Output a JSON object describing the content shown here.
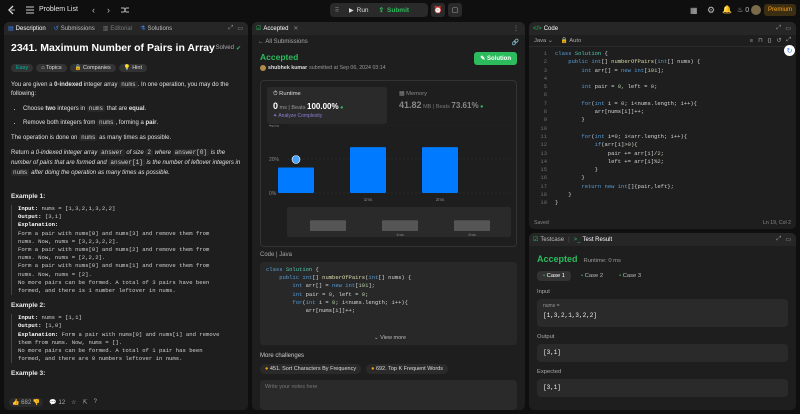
{
  "topbar": {
    "problem_list": "Problem List",
    "run": "Run",
    "submit": "Submit",
    "premium": "Premium",
    "fire_count": "0"
  },
  "desc_panel": {
    "tabs": [
      "Description",
      "Submissions",
      "Editorial",
      "Solutions"
    ],
    "title": "2341. Maximum Number of Pairs in Array",
    "solved": "Solved",
    "chips": [
      "Easy",
      "Topics",
      "Companies",
      "Hint"
    ],
    "p1a": "You are given a ",
    "p1b": "0-indexed",
    "p1c": " integer array ",
    "p1code": "nums",
    "p1d": ". In one operation, you may do the following:",
    "b1a": "Choose ",
    "b1b": "two",
    "b1c": " integers in ",
    "b1code": "nums",
    "b1d": " that are ",
    "b1e": "equal",
    "b2a": "Remove both integers from ",
    "b2code": "nums",
    "b2b": ", forming a ",
    "b2c": "pair",
    "p2a": "The operation is done on ",
    "p2code": "nums",
    "p2b": " as many times as possible.",
    "p3a": "Return ",
    "p3b": "a 0-indexed integer array ",
    "p3code1": "answer",
    "p3c": " of size ",
    "p3d": "2",
    "p3e": " where ",
    "p3code2": "answer[0]",
    "p3f": " is the number of pairs that are formed and ",
    "p3code3": "answer[1]",
    "p3g": " is the number of leftover integers in ",
    "p3code4": "nums",
    "p3h": " after doing the operation as many times as possible.",
    "ex1_title": "Example 1:",
    "ex1_lines": [
      [
        "Input:",
        " nums = [1,3,2,1,3,2,2]"
      ],
      [
        "Output:",
        " [3,1]"
      ],
      [
        "Explanation:",
        ""
      ],
      [
        "",
        "Form a pair with nums[0] and nums[3] and remove them from"
      ],
      [
        "",
        "nums. Now, nums = [3,2,3,2,2]."
      ],
      [
        "",
        "Form a pair with nums[0] and nums[2] and remove them from"
      ],
      [
        "",
        "nums. Now, nums = [2,2,2]."
      ],
      [
        "",
        "Form a pair with nums[0] and nums[1] and remove them from"
      ],
      [
        "",
        "nums. Now, nums = [2]."
      ],
      [
        "",
        "No more pairs can be formed. A total of 3 pairs have been"
      ],
      [
        "",
        "formed, and there is 1 number leftover in nums."
      ]
    ],
    "ex2_title": "Example 2:",
    "ex2_lines": [
      [
        "Input:",
        " nums = [1,1]"
      ],
      [
        "Output:",
        " [1,0]"
      ],
      [
        "Explanation:",
        " Form a pair with nums[0] and nums[1] and remove"
      ],
      [
        "",
        "them from nums. Now, nums = []."
      ],
      [
        "",
        "No more pairs can be formed. A total of 1 pair has been"
      ],
      [
        "",
        "formed, and there are 0 numbers leftover in nums."
      ]
    ],
    "ex3_title": "Example 3:",
    "likes": "682",
    "comments": "12"
  },
  "accepted_panel": {
    "tab": "Accepted",
    "all_submissions": "All Submissions",
    "status": "Accepted",
    "user": "shubhek kumar",
    "submitted": "submitted at Sep 06, 2024 03:14",
    "solution_btn": "Solution",
    "runtime_label": "Runtime",
    "runtime_value": "0",
    "runtime_unit": "ms",
    "beats_label": "Beats",
    "runtime_beats": "100.00%",
    "analyze": "Analyze Complexity",
    "memory_label": "Memory",
    "memory_value": "41.82",
    "memory_unit": "MB",
    "memory_beats": "73.61%",
    "code_label": "Code",
    "lang": "Java",
    "view_more": "View more",
    "more_challenges": "More challenges",
    "challenges": [
      "451. Sort Characters By Frequency",
      "692. Top K Frequent Words"
    ],
    "notes_placeholder": "Write your notes here"
  },
  "chart_data": {
    "type": "bar",
    "ytick_labels": [
      "40%",
      "20%",
      "0%"
    ],
    "ylim": [
      0,
      40
    ],
    "x_labels": [
      "1ms",
      "2ms"
    ],
    "values": [
      15,
      27,
      27,
      27
    ],
    "highlight_index": 0,
    "navigator_values": [
      12,
      18,
      18,
      18
    ],
    "navigator_labels": [
      "",
      "1ms",
      "2ms"
    ]
  },
  "code_panel": {
    "title": "Code",
    "lang": "Java",
    "auto": "Auto",
    "saved": "Saved",
    "position": "Ln 19, Col 2",
    "lines": [
      "class Solution {",
      "    public int[] numberOfPairs(int[] nums) {",
      "        int arr[] = new int[101];",
      "",
      "        int pair = 0, left = 0;",
      "",
      "        for(int i = 0; i<nums.length; i++){",
      "            arr[nums[i]]++;",
      "        }",
      "",
      "        for(int i=0; i<arr.length; i++){",
      "            if(arr[i]>0){",
      "                pair += arr[i]/2;",
      "                left += arr[i]%2;",
      "            }",
      "        }",
      "        return new int[]{pair,left};",
      "    }",
      "}"
    ]
  },
  "submitted_code": [
    "class Solution {",
    "    public int[] numberOfPairs(int[] nums) {",
    "        int arr[] = new int[101];",
    "",
    "        int pair = 0, left = 0;",
    "",
    "        for(int i = 0; i<nums.length; i++){",
    "            arr[nums[i]]++;"
  ],
  "test_panel": {
    "tab1": "Testcase",
    "tab2": "Test Result",
    "status": "Accepted",
    "runtime": "Runtime: 0 ms",
    "cases": [
      "Case 1",
      "Case 2",
      "Case 3"
    ],
    "input_label": "Input",
    "param": "nums =",
    "input_value": "[1,3,2,1,3,2,2]",
    "output_label": "Output",
    "output_value": "[3,1]",
    "expected_label": "Expected",
    "expected_value": "[3,1]"
  },
  "colors": {
    "accent_green": "#2cbb5d",
    "bar_blue": "#007aff",
    "orange": "#ffa116",
    "easy_teal": "#00b8a3"
  }
}
